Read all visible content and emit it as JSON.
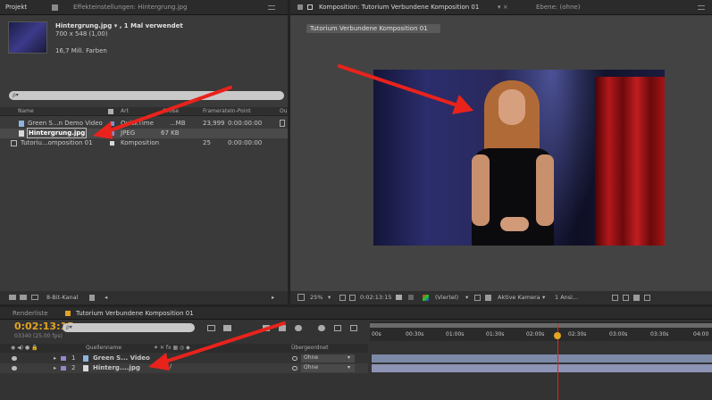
{
  "project_panel": {
    "tabs": [
      "Projekt",
      "Effekteinstellungen: Hintergrung.jpg"
    ],
    "item_title": "Hintergrung.jpg ▾ , 1 Mal verwendet",
    "item_dims": "700 x 548 (1,00)",
    "item_colors": "16,7 Mill. Farben",
    "search_placeholder": "ρ▾",
    "columns": [
      "Name",
      "Art",
      "Größe",
      "Framerate",
      "In-Point",
      "Ou"
    ],
    "rows": [
      {
        "name": "Green S...n Demo Video",
        "type": "QuickTime",
        "size": "...MB",
        "fps": "23,999",
        "inpoint": "0:00:00:00"
      },
      {
        "name": "Hintergrung.jpg",
        "type": "JPEG",
        "size": "67 KB",
        "fps": "",
        "inpoint": ""
      },
      {
        "name": "Tutoriu...omposition 01",
        "type": "Komposition",
        "size": "",
        "fps": "25",
        "inpoint": "0:00:00:00"
      }
    ],
    "footer_label": "8-Bit-Kanal"
  },
  "comp_panel": {
    "tabs": [
      "Komposition: Tutorium Verbundene Komposition 01",
      "Ebene: (ohne)"
    ],
    "subtab": "Tutorium Verbundene Komposition 01",
    "zoom": "25%",
    "timecode": "0:02:13:15",
    "resolution": "(Viertel)",
    "camera": "Aktive Kamera",
    "views": "1 Ansi..."
  },
  "timeline_panel": {
    "tabs": [
      "Renderliste",
      "Tutorium Verbundene Komposition 01"
    ],
    "timecode": "0:02:13:15",
    "frames": "03340 (25.00 fps)",
    "search_placeholder": "ρ▾",
    "col_header_name": "Quellenname",
    "col_header_parent": "Übergeordnet",
    "layers": [
      {
        "num": "1",
        "name": "Green S... Video",
        "parent": "Ohne"
      },
      {
        "num": "2",
        "name": "Hinterg....jpg",
        "parent": "Ohne"
      }
    ],
    "ruler": [
      "00s",
      "00:30s",
      "01:00s",
      "01:30s",
      "02:00s",
      "02:30s",
      "03:00s",
      "03:30s",
      "04:00"
    ]
  },
  "colors": {
    "accent_red": "#e8231c",
    "timecode": "#e2a421",
    "panel": "#3a3a3a"
  }
}
